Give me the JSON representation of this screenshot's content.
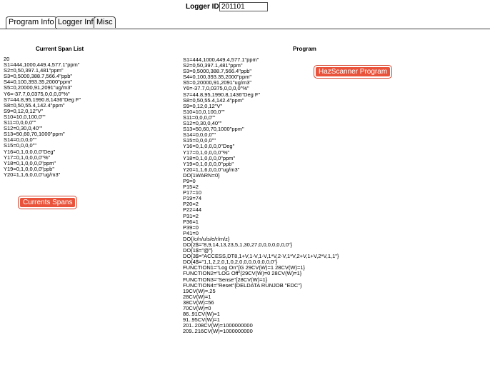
{
  "header": {
    "logger_label": "Logger ID",
    "logger_value": "201101"
  },
  "tabs": [
    {
      "label": "Program Info"
    },
    {
      "label": "Logger Info"
    },
    {
      "label": "Misc"
    }
  ],
  "left": {
    "heading": "Current Span List",
    "lines": [
      "20",
      "S1=444,1000,449.4,577.1\"ppm\"",
      "S2=0,50,397.1,481\"ppm\"",
      "S3=0,5000,388.7,566.4\"ppb\"",
      "S4=0,100,393.35,2000\"ppm\"",
      "S5=0,20000,91,2091\"ug/m3\"",
      "Y6=-37.7,0,0375,0,0,0,0\"%\"",
      "S7=44.8,95,1990.8,1436\"Deg F\"",
      "S8=0,50,55.4,142.4\"ppm\"",
      "S9=0,12,0,12\"V\"",
      "S10=10,0,100,0\"\"",
      "S11=0,0,0,0\"\"",
      "S12=0,30,0,40\"\"",
      "S13=50,60,70,1000\"ppm\"",
      "S14=0,0,0,0\"\"",
      "S15=0,0,0,0\"\"",
      "Y16=0,1,0,0,0,0\"Deg\"",
      "Y17=0,1,0,0,0,0\"%\"",
      "Y18=0,1,0,0,0,0\"ppm\"",
      "Y19=0,1,0,0,0,0\"ppb\"",
      "Y20=1,1,6,0,0,0\"ug/m3\""
    ]
  },
  "right": {
    "heading": "Program",
    "lines": [
      "S1=444,1000,449.4,577.1\"ppm\"",
      "S2=0,50,397.1,481\"ppm\"",
      "S3=0,5000,388.7,566.4\"ppb\"",
      "S4=0,100,393.35,2000\"ppm\"",
      "S5=0,20000,91,2091\"ug/m3\"",
      "Y6=-37.7,0,0375,0,0,0,0\"%\"",
      "S7=44.8,95,1990.8,1436\"Deg F\"",
      "S8=0,50,55.4,142.4\"ppm\"",
      "S9=0,12,0,12\"V\"",
      "S10=10,0,100,0\"\"",
      "S11=0,0,0,0\"\"",
      "S12=0,30,0,40\"\"",
      "S13=50,60,70,1000\"ppm\"",
      "S14=0,0,0,0\"\"",
      "S15=0,0,0,0\"\"",
      "Y16=0,1,0,0,0,0\"Deg\"",
      "Y17=0,1,0,0,0,0\"%\"",
      "Y18=0,1,0,0,0,0\"ppm\"",
      "Y19=0,1,0,0,0,0\"ppb\"",
      "Y20=1,1,6,0,0,0\"ug/m3\"",
      "DO{1WARN=0}",
      "P9=0",
      "P15=2",
      "P17=10",
      "P19=74",
      "P20=2",
      "P22=44",
      "P31=2",
      "P36=1",
      "P39=0",
      "P41=0",
      "DO{/c/n/u/s/e/r/m/z}",
      "DO{2$=\"8,9,14,13,23,5,1,30,27,0,0,0,0,0,0,0\"}",
      "DO{1$=\"@\"}",
      "DO{3$=\"ACCESS,DT8,1+V,1-V,1-V,1*V,2-V,1*V,2+V,1+V,2*V,1,1\"}",
      "DO{4$=\"1,1,2,2,0,1,0,2,0,0,0,0,0,0,0,0\"}",
      "FUNCTION1=\"Log On\"{G 29CV(W)=1 28CV(W)=1}",
      "FUNCTION2=\"LOG Off\"{29CV(W)=0 28CV(W)=1}",
      "FUNCTION3=\"Sense\"{28CV(W)=1}",
      "FUNCTION4=\"Reset\"{DELDATA RUNJOB \"EDC\"}",
      "19CV(W)=.25",
      "28CV(W)=1",
      "38CV(W)=56",
      "70CV(W)=0",
      "86..91CV(W)=1",
      "91..95CV(W)=1",
      "201..208CV(W)=1000000000",
      "209..216CV(W)=1000000000"
    ]
  },
  "callouts": {
    "hazscanner": "HazScanner Program",
    "currents": "Currents Spans"
  }
}
